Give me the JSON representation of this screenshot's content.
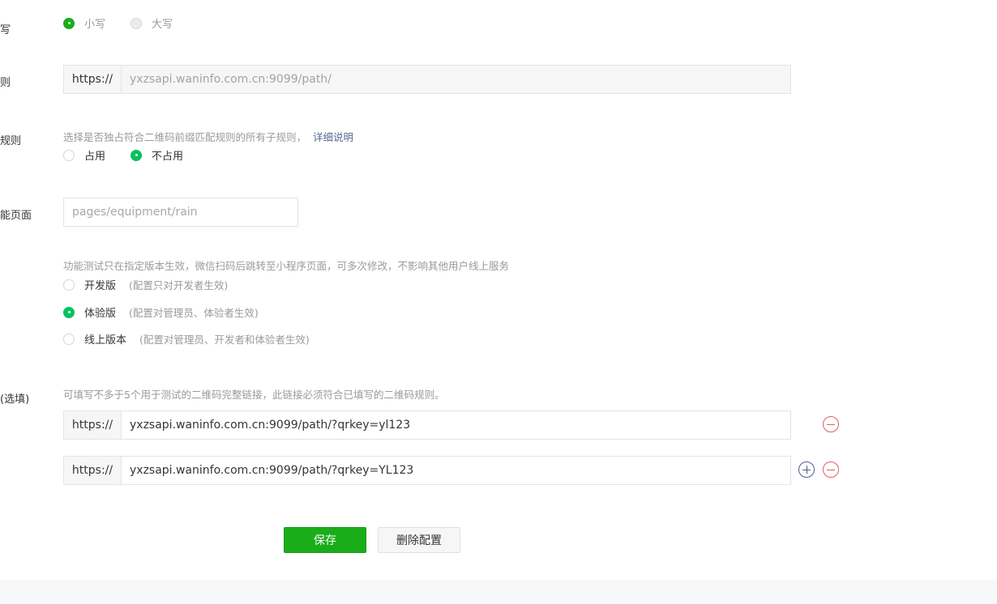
{
  "case_field": {
    "label": "写",
    "options": [
      {
        "label": "小写",
        "selected": true
      },
      {
        "label": "大写",
        "selected": false
      }
    ]
  },
  "rule_field": {
    "label": "则",
    "prefix": "https://",
    "value": "yxzsapi.waninfo.com.cn:9099/path/"
  },
  "exclusive_field": {
    "label": "规则",
    "hint": "选择是否独占符合二维码前缀匹配规则的所有子规则，",
    "link": "详细说明",
    "options": [
      {
        "label": "占用",
        "selected": false
      },
      {
        "label": "不占用",
        "selected": true
      }
    ]
  },
  "page_field": {
    "label": "能页面",
    "placeholder": "pages/equipment/rain"
  },
  "version_field": {
    "hint": "功能测试只在指定版本生效，微信扫码后跳转至小程序页面，可多次修改，不影响其他用户线上服务",
    "options": [
      {
        "label": "开发版",
        "note": "(配置只对开发者生效)",
        "selected": false
      },
      {
        "label": "体验版",
        "note": "(配置对管理员、体验者生效)",
        "selected": true
      },
      {
        "label": "线上版本",
        "note": "(配置对管理员、开发者和体验者生效)",
        "selected": false
      }
    ]
  },
  "test_links_field": {
    "label": "(选填)",
    "hint": "可填写不多于5个用于测试的二维码完整链接，此链接必须符合已填写的二维码规则。",
    "links": [
      {
        "prefix": "https://",
        "value": "yxzsapi.waninfo.com.cn:9099/path/?qrkey=yl123"
      },
      {
        "prefix": "https://",
        "value": "yxzsapi.waninfo.com.cn:9099/path/?qrkey=YL123"
      }
    ]
  },
  "actions": {
    "save_label": "保存",
    "delete_label": "删除配置"
  },
  "colors": {
    "primary_green": "#1aad19",
    "radio_green": "#07c160",
    "link_blue": "#576b95",
    "remove_red": "#e15f5f"
  }
}
